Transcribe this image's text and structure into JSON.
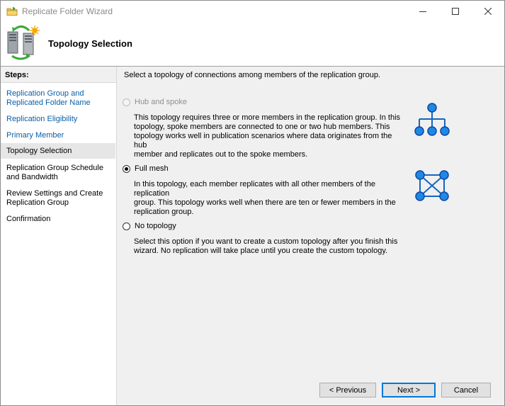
{
  "window": {
    "title": "Replicate Folder Wizard"
  },
  "header": {
    "heading": "Topology Selection"
  },
  "steps": {
    "title": "Steps:",
    "items": [
      {
        "line1": "Replication Group and",
        "line2": "Replicated Folder Name",
        "state": "link"
      },
      {
        "line1": "Replication Eligibility",
        "line2": "",
        "state": "link"
      },
      {
        "line1": "Primary Member",
        "line2": "",
        "state": "link"
      },
      {
        "line1": "Topology Selection",
        "line2": "",
        "state": "current"
      },
      {
        "line1": "Replication Group Schedule",
        "line2": "and Bandwidth",
        "state": "plain"
      },
      {
        "line1": "Review Settings and Create",
        "line2": "Replication Group",
        "state": "plain"
      },
      {
        "line1": "Confirmation",
        "line2": "",
        "state": "plain"
      }
    ]
  },
  "main": {
    "intro": "Select a topology of connections among members of the replication group.",
    "options": [
      {
        "label": "Hub and spoke",
        "selected": false,
        "disabled": true,
        "desc": [
          "This topology requires three or more members in the replication group. In this",
          "topology, spoke members are connected to one or two hub members. This",
          "topology works well in publication scenarios where data originates from the hub",
          "member and replicates out to the spoke members."
        ],
        "icon": "hub-spoke-icon"
      },
      {
        "label": "Full mesh",
        "selected": true,
        "disabled": false,
        "desc": [
          "In this topology, each member replicates with all other members of the replication",
          "group. This topology works well when there are ten or fewer members in the",
          "replication group."
        ],
        "icon": "full-mesh-icon"
      },
      {
        "label": "No topology",
        "selected": false,
        "disabled": false,
        "desc": [
          "Select this option if you want to create a custom topology after you finish this",
          "wizard. No replication will take place until you create the custom topology."
        ],
        "icon": ""
      }
    ]
  },
  "buttons": {
    "previous": "< Previous",
    "next": "Next >",
    "cancel": "Cancel"
  },
  "colors": {
    "link": "#0b5ea8",
    "icon_blue": "#1e88e5",
    "focus_blue": "#0078d7"
  }
}
